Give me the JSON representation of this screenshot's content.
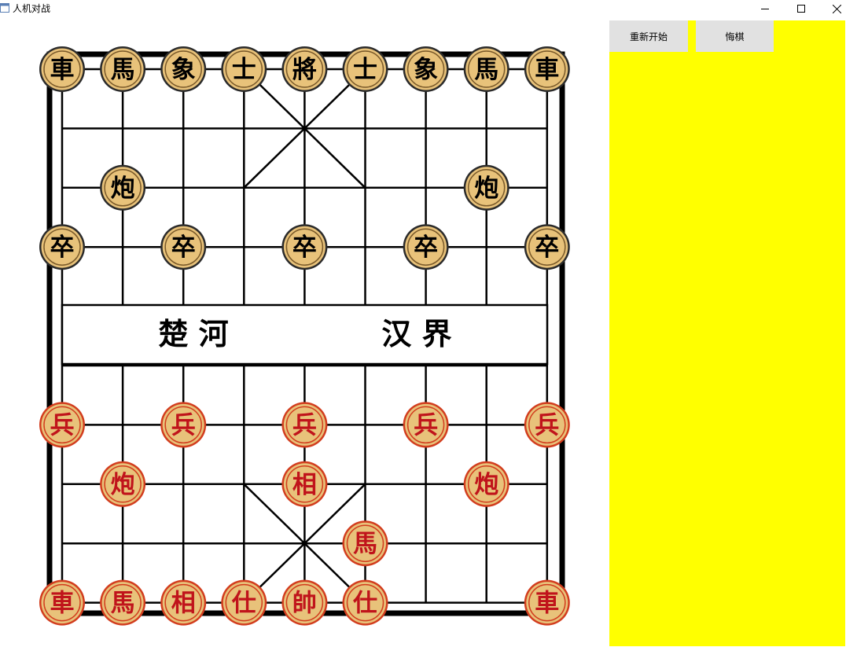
{
  "window": {
    "title": "人机对战",
    "app_icon": "app-window-icon",
    "controls": [
      "minimize-icon",
      "maximize-icon",
      "close-icon"
    ]
  },
  "board": {
    "river_left": "楚 河",
    "river_right": "汉 界",
    "colors": {
      "line": "#000000",
      "piece_face": "#e8c27a",
      "black_piece_ring": "#2b2b2b",
      "red_piece_ring": "#d23d1e",
      "red_piece_text": "#c0141b",
      "black_piece_text": "#000000"
    },
    "pieces": [
      {
        "side": "black",
        "label": "車",
        "file": 0,
        "rank": 0
      },
      {
        "side": "black",
        "label": "馬",
        "file": 1,
        "rank": 0
      },
      {
        "side": "black",
        "label": "象",
        "file": 2,
        "rank": 0
      },
      {
        "side": "black",
        "label": "士",
        "file": 3,
        "rank": 0
      },
      {
        "side": "black",
        "label": "將",
        "file": 4,
        "rank": 0
      },
      {
        "side": "black",
        "label": "士",
        "file": 5,
        "rank": 0
      },
      {
        "side": "black",
        "label": "象",
        "file": 6,
        "rank": 0
      },
      {
        "side": "black",
        "label": "馬",
        "file": 7,
        "rank": 0
      },
      {
        "side": "black",
        "label": "車",
        "file": 8,
        "rank": 0
      },
      {
        "side": "black",
        "label": "炮",
        "file": 1,
        "rank": 2
      },
      {
        "side": "black",
        "label": "炮",
        "file": 7,
        "rank": 2
      },
      {
        "side": "black",
        "label": "卒",
        "file": 0,
        "rank": 3
      },
      {
        "side": "black",
        "label": "卒",
        "file": 2,
        "rank": 3
      },
      {
        "side": "black",
        "label": "卒",
        "file": 4,
        "rank": 3
      },
      {
        "side": "black",
        "label": "卒",
        "file": 6,
        "rank": 3
      },
      {
        "side": "black",
        "label": "卒",
        "file": 8,
        "rank": 3
      },
      {
        "side": "red",
        "label": "兵",
        "file": 0,
        "rank": 6
      },
      {
        "side": "red",
        "label": "兵",
        "file": 2,
        "rank": 6
      },
      {
        "side": "red",
        "label": "兵",
        "file": 4,
        "rank": 6
      },
      {
        "side": "red",
        "label": "兵",
        "file": 6,
        "rank": 6
      },
      {
        "side": "red",
        "label": "兵",
        "file": 8,
        "rank": 6
      },
      {
        "side": "red",
        "label": "炮",
        "file": 1,
        "rank": 7
      },
      {
        "side": "red",
        "label": "相",
        "file": 4,
        "rank": 7
      },
      {
        "side": "red",
        "label": "炮",
        "file": 7,
        "rank": 7
      },
      {
        "side": "red",
        "label": "馬",
        "file": 5,
        "rank": 8
      },
      {
        "side": "red",
        "label": "車",
        "file": 0,
        "rank": 9
      },
      {
        "side": "red",
        "label": "馬",
        "file": 1,
        "rank": 9
      },
      {
        "side": "red",
        "label": "相",
        "file": 2,
        "rank": 9
      },
      {
        "side": "red",
        "label": "仕",
        "file": 3,
        "rank": 9
      },
      {
        "side": "red",
        "label": "帥",
        "file": 4,
        "rank": 9
      },
      {
        "side": "red",
        "label": "仕",
        "file": 5,
        "rank": 9
      },
      {
        "side": "red",
        "label": "車",
        "file": 8,
        "rank": 9
      }
    ]
  },
  "panel": {
    "background": "#ffff00",
    "restart_label": "重新开始",
    "undo_label": "悔棋"
  }
}
